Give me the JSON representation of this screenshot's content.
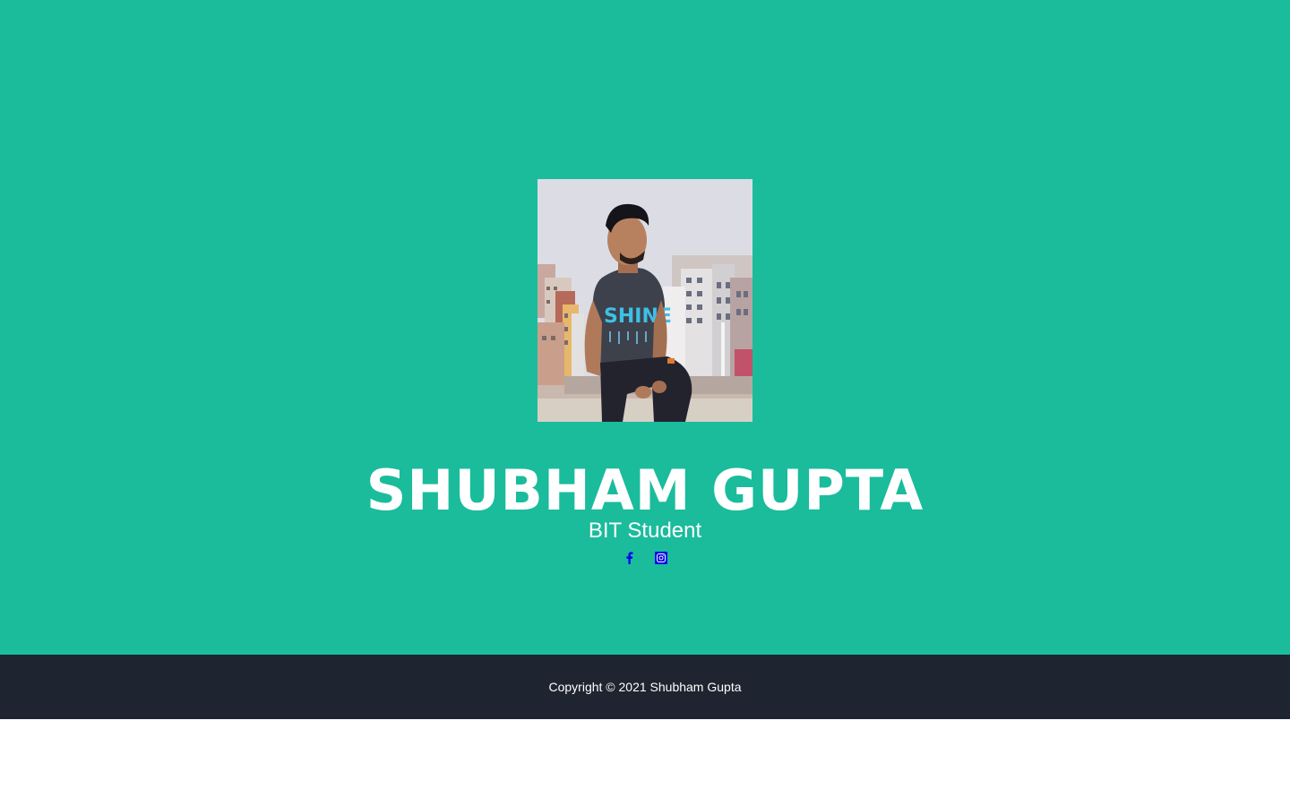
{
  "profile": {
    "name": "SHUBHAM GUPTA",
    "role": "BIT Student",
    "photo_alt": "Shubham Gupta"
  },
  "socials": [
    {
      "icon": "facebook-icon",
      "label": "Facebook"
    },
    {
      "icon": "instagram-icon",
      "label": "Instagram"
    }
  ],
  "footer": {
    "copyright": "Copyright © 2021 Shubham Gupta"
  },
  "colors": {
    "hero_bg": "#1abc9c",
    "footer_bg": "#1e2530",
    "text": "#ffffff",
    "icon": "#0000ee"
  }
}
